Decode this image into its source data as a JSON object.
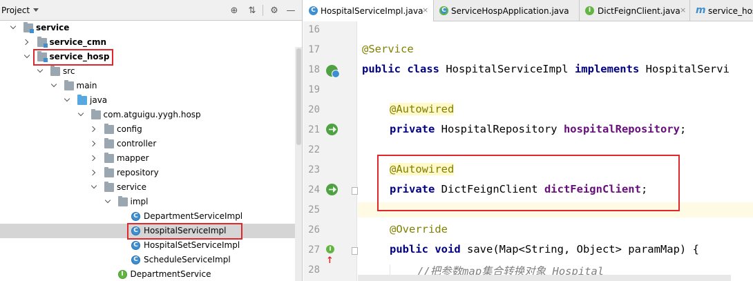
{
  "project_pane": {
    "title": "Project",
    "toolbar_icons": [
      "crosshair-icon",
      "collapse-icon",
      "gear-icon",
      "hide-icon"
    ],
    "tree": [
      {
        "label": "service",
        "bold": true,
        "icon": "module-icon",
        "indent": 0,
        "expanded": true
      },
      {
        "label": "service_cmn",
        "bold": true,
        "icon": "module-icon",
        "indent": 1,
        "expanded": false
      },
      {
        "label": "service_hosp",
        "bold": true,
        "icon": "module-icon",
        "indent": 1,
        "expanded": true,
        "highlighted": true
      },
      {
        "label": "src",
        "icon": "folder-icon",
        "indent": 2,
        "expanded": true
      },
      {
        "label": "main",
        "icon": "folder-icon",
        "indent": 3,
        "expanded": true
      },
      {
        "label": "java",
        "icon": "source-folder-icon",
        "indent": 4,
        "expanded": true
      },
      {
        "label": "com.atguigu.yygh.hosp",
        "icon": "package-icon",
        "indent": 5,
        "expanded": true
      },
      {
        "label": "config",
        "icon": "package-icon",
        "indent": 6,
        "expanded": false
      },
      {
        "label": "controller",
        "icon": "package-icon",
        "indent": 6,
        "expanded": false
      },
      {
        "label": "mapper",
        "icon": "package-icon",
        "indent": 6,
        "expanded": false
      },
      {
        "label": "repository",
        "icon": "package-icon",
        "indent": 6,
        "expanded": false
      },
      {
        "label": "service",
        "icon": "package-icon",
        "indent": 6,
        "expanded": true
      },
      {
        "label": "impl",
        "icon": "package-icon",
        "indent": 7,
        "expanded": true
      },
      {
        "label": "DepartmentServiceImpl",
        "icon": "class-icon",
        "indent": 8
      },
      {
        "label": "HospitalServiceImpl",
        "icon": "class-icon",
        "indent": 8,
        "selected": true,
        "highlighted": true
      },
      {
        "label": "HospitalSetServiceImpl",
        "icon": "class-icon",
        "indent": 8
      },
      {
        "label": "ScheduleServiceImpl",
        "icon": "class-icon",
        "indent": 8
      },
      {
        "label": "DepartmentService",
        "icon": "interface-icon",
        "indent": 7
      }
    ]
  },
  "editor": {
    "tabs": [
      {
        "label": "HospitalServiceImpl.java",
        "icon": "class-icon",
        "active": true
      },
      {
        "label": "ServiceHospApplication.java",
        "icon": "spring-class-icon",
        "active": false
      },
      {
        "label": "DictFeignClient.java",
        "icon": "interface-icon",
        "active": false
      },
      {
        "label": "service_hos",
        "icon": "maven-icon",
        "active": false
      }
    ],
    "tab_close_glyph": "×",
    "gutter": [
      {
        "line": "16"
      },
      {
        "line": "17"
      },
      {
        "line": "18",
        "marker": "spring-bean-icon"
      },
      {
        "line": "19"
      },
      {
        "line": "20"
      },
      {
        "line": "21",
        "marker": "autowired-navigate-icon"
      },
      {
        "line": "22"
      },
      {
        "line": "23"
      },
      {
        "line": "24",
        "marker": "autowired-navigate-icon"
      },
      {
        "line": "25"
      },
      {
        "line": "26"
      },
      {
        "line": "27",
        "marker": "override-implements-icon"
      },
      {
        "line": "28"
      }
    ],
    "code": {
      "l16": "",
      "l17_ann": "@Service",
      "l18_kw": "public class",
      "l18_name": " HospitalServiceImpl ",
      "l18_kw2": "implements",
      "l18_rest": " HospitalServi",
      "l19": "",
      "l20_ann": "@Autowired",
      "l21_kw": "private",
      "l21_type": " HospitalRepository ",
      "l21_field": "hospitalRepository",
      "l21_end": ";",
      "l22": "",
      "l23_ann": "@Autowired",
      "l24_kw": "private",
      "l24_type": " DictFeignClient ",
      "l24_field": "dictFeignClient",
      "l24_end": ";",
      "l25": "",
      "l26_ann": "@Override",
      "l27_kw": "public void",
      "l27_rest": " save(Map<String, Object> paramMap) {",
      "l28_cmt": "//把参数map集合转换对象 Hospital"
    }
  },
  "colors": {
    "highlight_box": "#e0262b",
    "annotation": "#808000",
    "keyword": "#000080",
    "field": "#660e7a",
    "comment": "#808080",
    "selected_row": "#d5d5d5"
  }
}
